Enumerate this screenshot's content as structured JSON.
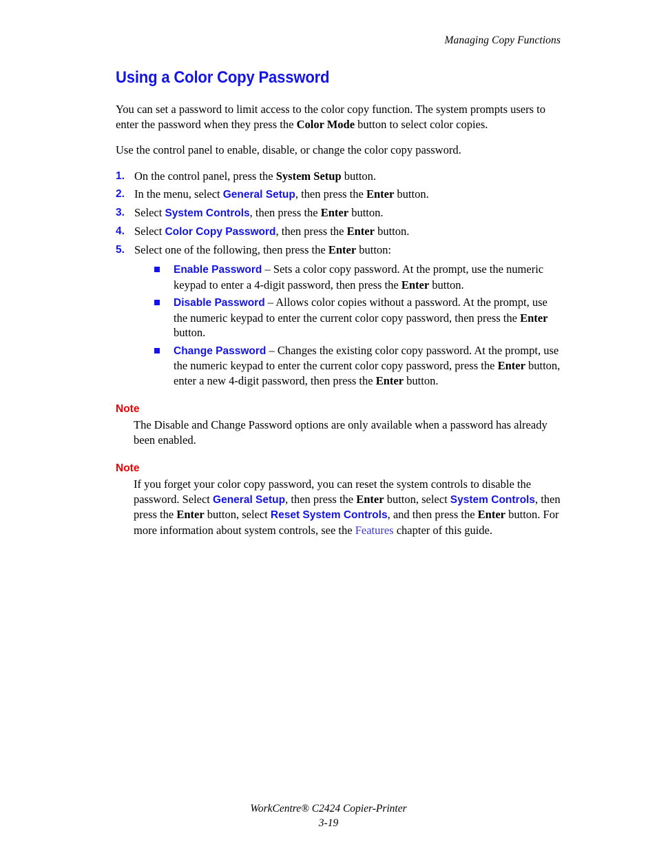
{
  "header": {
    "running_head": "Managing Copy Functions"
  },
  "colors": {
    "heading_blue": "#1414e6",
    "menu_blue": "#1414e6",
    "link_blue": "#3a3ad0",
    "note_red": "#ee0000",
    "body_black": "#000000",
    "page_background": "#ffffff"
  },
  "title": "Using a Color Copy Password",
  "intro": {
    "para1_a": "You can set a password to limit access to the color copy function. The system prompts users to enter the password when they press the ",
    "para1_bold": "Color Mode",
    "para1_b": " button to select color copies.",
    "para2": "Use the control panel to enable, disable, or change the color copy password."
  },
  "steps": [
    {
      "num": "1.",
      "seg_a": "On the control panel, press the ",
      "bold_1": "System Setup",
      "seg_b": " button."
    },
    {
      "num": "2.",
      "seg_a": "In the menu, select ",
      "menu_1": "General Setup",
      "seg_b": ", then press the ",
      "bold_1": "Enter",
      "seg_c": " button."
    },
    {
      "num": "3.",
      "seg_a": "Select ",
      "menu_1": "System Controls",
      "seg_b": ", then press the ",
      "bold_1": "Enter",
      "seg_c": " button."
    },
    {
      "num": "4.",
      "seg_a": "Select ",
      "menu_1": "Color Copy Password",
      "seg_b": ", then press the ",
      "bold_1": "Enter",
      "seg_c": " button."
    },
    {
      "num": "5.",
      "seg_a": "Select one of the following, then press the ",
      "bold_1": "Enter",
      "seg_b": " button:"
    }
  ],
  "sub_bullets": [
    {
      "bullet": "square-bullet",
      "menu_1": "Enable Password",
      "seg_a": " – Sets a color copy password. At the prompt, use the numeric keypad to enter a 4-digit password, then press the ",
      "bold_1": "Enter",
      "seg_b": " button."
    },
    {
      "bullet": "square-bullet",
      "menu_1": "Disable Password",
      "seg_a": " – Allows color copies without a password. At the prompt, use the numeric keypad to enter the current color copy password, then press the ",
      "bold_1": "Enter",
      "seg_b": " button."
    },
    {
      "bullet": "square-bullet",
      "menu_1": "Change Password",
      "seg_a": " – Changes the existing color copy password. At the prompt, use the numeric keypad to enter the current color copy password, press the ",
      "bold_1": "Enter",
      "seg_b": " button, enter a new 4-digit password, then press the ",
      "bold_2": "Enter",
      "seg_c": " button."
    }
  ],
  "note_1": {
    "label": "Note",
    "body": "The Disable and Change Password options are only available when a password has already been enabled."
  },
  "note_2": {
    "label": "Note",
    "seg_a": "If you forget your color copy password, you can reset the system controls to disable the password. Select ",
    "menu_1": "General Setup",
    "seg_b": ", then press the ",
    "bold_1": "Enter",
    "seg_c": " button, select ",
    "menu_2": "System Controls",
    "seg_d": ", then press the ",
    "bold_2": "Enter",
    "seg_e": " button, select ",
    "menu_3": "Reset System Controls",
    "seg_f": ", and then press the ",
    "bold_3": "Enter",
    "seg_g": " button. For more information about system controls, see the ",
    "link_1": "Features",
    "seg_h": " chapter of this guide."
  },
  "footer": {
    "line1": "WorkCentre® C2424 Copier-Printer",
    "line2": "3-19"
  }
}
